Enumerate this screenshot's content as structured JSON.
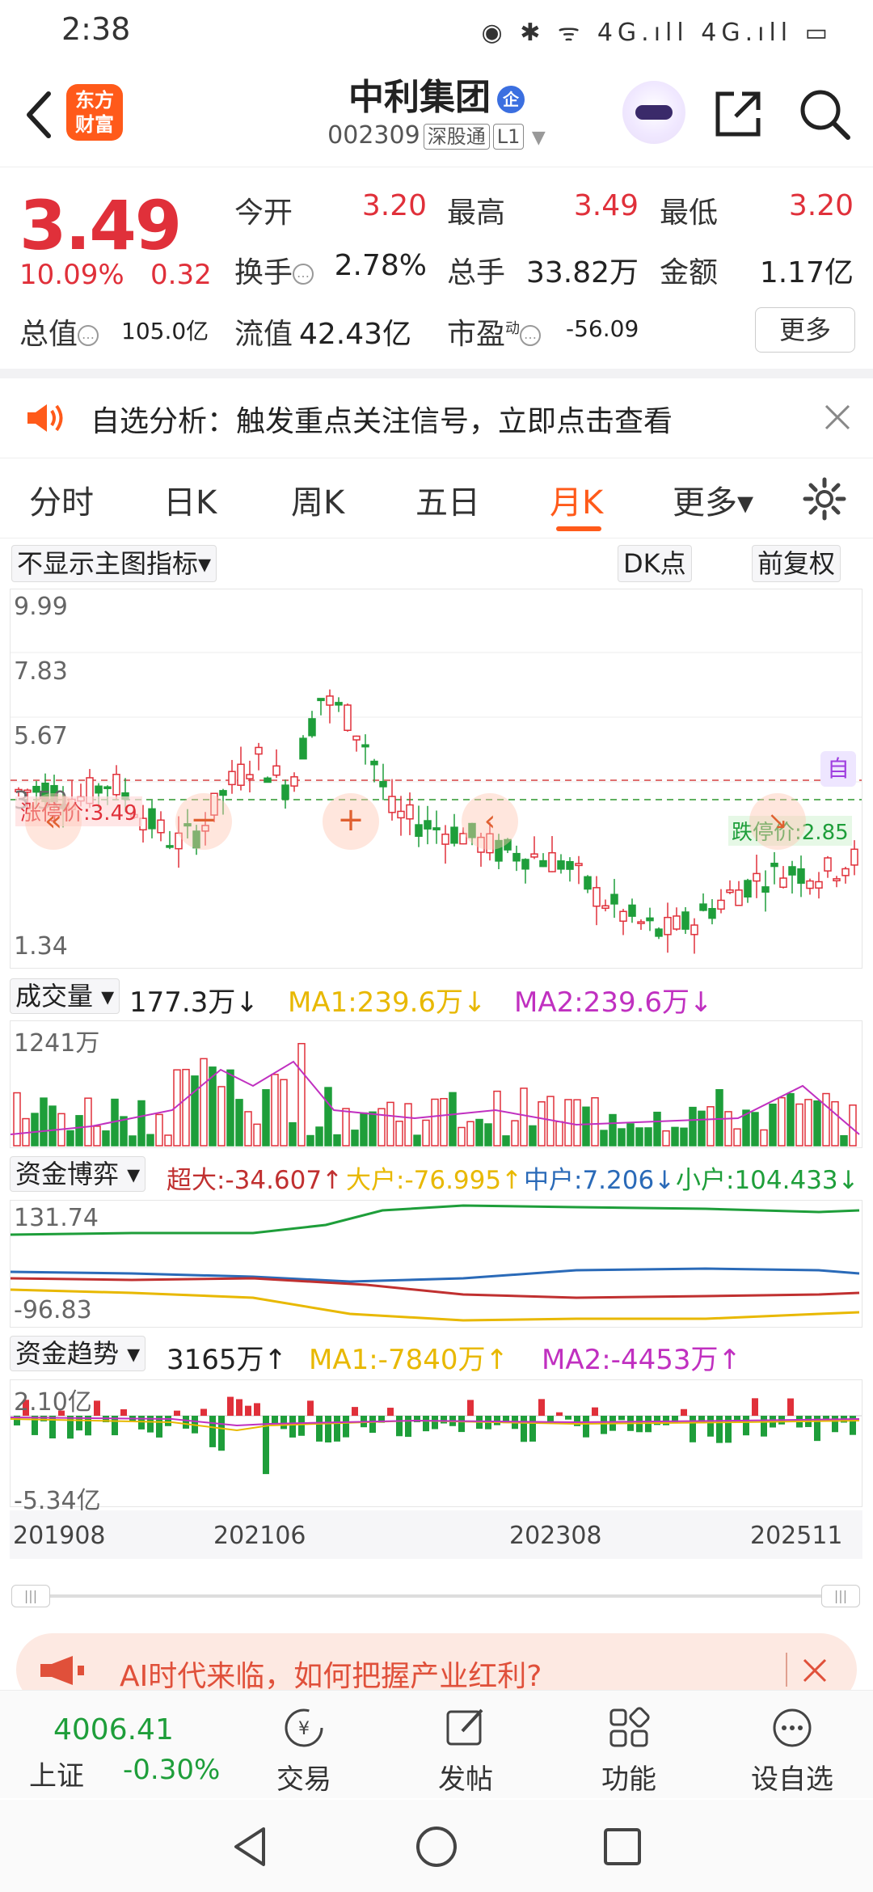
{
  "status_bar": {
    "time": "2:38",
    "icons": "◉ ✱ ᯤ 4G.ıll 4G.ıll ▭"
  },
  "header": {
    "stock_name": "中利集团",
    "badge": "企",
    "stock_code": "002309",
    "market_tag": "深股通",
    "level_tag": "L1",
    "logo_line1": "东方",
    "logo_line2": "财富"
  },
  "quote": {
    "price": "3.49",
    "change_pct": "10.09%",
    "change": "0.32",
    "rows": [
      [
        {
          "label": "今开",
          "value": "3.20",
          "color": "#e0303a"
        },
        {
          "label": "最高",
          "value": "3.49",
          "color": "#e0303a"
        },
        {
          "label": "最低",
          "value": "3.20",
          "color": "#e0303a"
        }
      ],
      [
        {
          "label": "换手",
          "value": "2.78%",
          "color": "#222"
        },
        {
          "label": "总手",
          "value": "33.82万",
          "color": "#222"
        },
        {
          "label": "金额",
          "value": "1.17亿",
          "color": "#222"
        }
      ]
    ],
    "total_value_label": "总值",
    "total_value": "105.0亿",
    "float_value_label": "流值",
    "float_value": "42.43亿",
    "pe_label": "市盈",
    "pe_sup": "动",
    "pe_value": "-56.09",
    "more_label": "更多"
  },
  "notice": {
    "text": "自选分析：触发重点关注信号，立即点击查看"
  },
  "tabs": [
    "分时",
    "日K",
    "周K",
    "五日",
    "月K",
    "更多▾"
  ],
  "active_tab": "月K",
  "chart_controls": {
    "indicator": "不显示主图指标▾",
    "dk": "DK点",
    "adjust": "前复权"
  },
  "main_chart": {
    "y_labels": [
      "9.99",
      "7.83",
      "5.67",
      "3.50",
      "1.34"
    ],
    "limit_up_label": "涨停价:3.49",
    "limit_down_label": "跌停价:2.85",
    "self_label": "自"
  },
  "volume": {
    "selector": "成交量 ▾",
    "value": "177.3万↓",
    "ma1": "MA1:239.6万↓",
    "ma2": "MA2:239.6万↓",
    "max_label": "1241万"
  },
  "capital_game": {
    "selector": "资金博弈 ▾",
    "super": "超大:-34.607↑",
    "large": "大户:-76.995↑",
    "medium": "中户:7.206↓",
    "small": "小户:104.433↓",
    "top_label": "131.74",
    "bottom_label": "-96.83"
  },
  "capital_trend": {
    "selector": "资金趋势 ▾",
    "value": "3165万↑",
    "ma1": "MA1:-7840万↑",
    "ma2": "MA2:-4453万↑",
    "top_label": "2.10亿",
    "bottom_label": "-5.34亿"
  },
  "time_axis": [
    "201908",
    "202106",
    "202308",
    "202511"
  ],
  "ad": {
    "text": "AI时代来临，如何把握产业红利?"
  },
  "bottom_nav": {
    "index_value": "4006.41",
    "index_name": "上证",
    "index_change": "-0.30%",
    "items": [
      "交易",
      "发帖",
      "功能",
      "设自选"
    ]
  },
  "colors": {
    "up": "#e0303a",
    "down": "#1e9e3a",
    "accent": "#ff5a1a",
    "ma1": "#e8b800",
    "ma2": "#c030c0"
  }
}
